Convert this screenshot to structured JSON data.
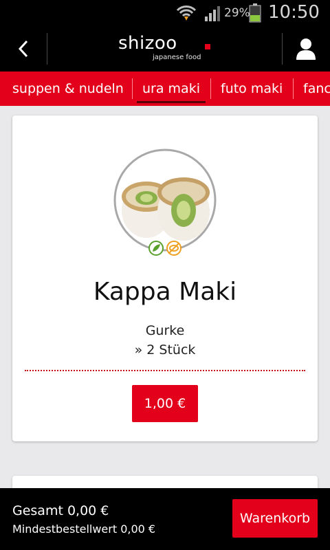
{
  "status_bar": {
    "battery_percent": "29%",
    "time": "10:50"
  },
  "header": {
    "logo_main": "shizoo",
    "logo_sub": "japanese food",
    "back_icon": "chevron-left-icon",
    "user_icon": "user-icon"
  },
  "tabs": [
    {
      "label": "suppen & nudeln",
      "active": false
    },
    {
      "label": "ura maki",
      "active": true
    },
    {
      "label": "futo maki",
      "active": false
    },
    {
      "label": "fanc",
      "active": false
    }
  ],
  "product": {
    "title": "Kappa Maki",
    "description": "Gurke",
    "quantity": "» 2 Stück",
    "price": "1,00 €",
    "badges": [
      "vegetarian-icon",
      "no-fish-icon"
    ]
  },
  "footer": {
    "total": "Gesamt  0,00 €",
    "min_order": "Mindestbestellwert 0,00 €",
    "cart_label": "Warenkorb"
  },
  "colors": {
    "brand_red": "#e2001a",
    "background": "#e9e9eb",
    "bar_black": "#000000"
  }
}
